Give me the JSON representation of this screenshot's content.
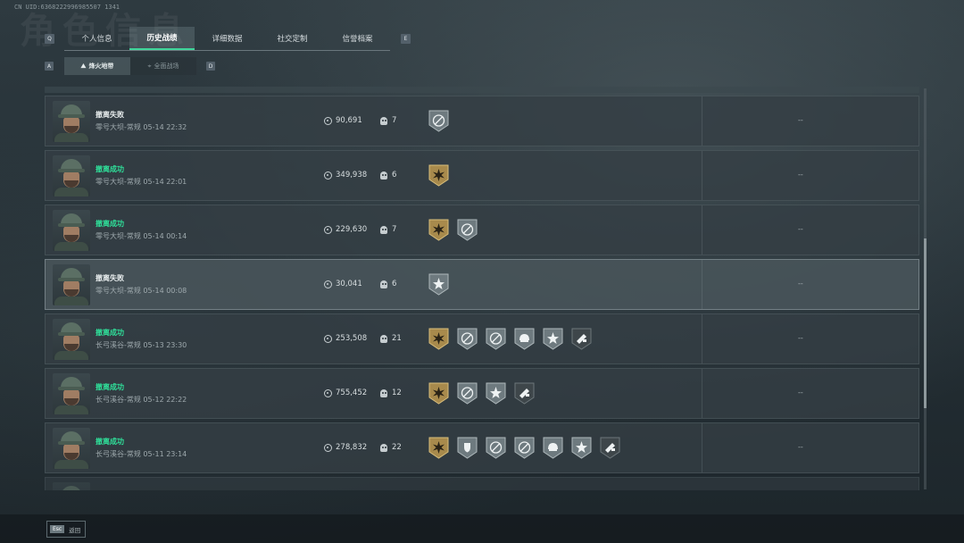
{
  "uid": "CN UID:6368222996985507 1341",
  "bg_title": "角色信息",
  "key_left": "Q",
  "key_right": "E",
  "subkey_left": "A",
  "subkey_right": "D",
  "tabs": [
    "个人信息",
    "历史战绩",
    "详细数据",
    "社交定制",
    "信誉档案"
  ],
  "active_tab": "历史战绩",
  "subtabs": [
    {
      "label": "烽火地带",
      "icon": "mountain-icon"
    },
    {
      "label": "全面战场",
      "icon": "crosshair-icon"
    }
  ],
  "colors": {
    "success": "#2fe09a",
    "fail": "#e6ebec",
    "badge_gold": "#b8995a",
    "badge_silver": "#8c979b"
  },
  "rows": [
    {
      "status": "撤离失败",
      "outcome": "fail",
      "map": "零号大坝-常规 05-14 22:32",
      "money": "90,691",
      "kills": "7",
      "badges": [
        "silver-no-ammo"
      ],
      "right": "--",
      "highlight": false
    },
    {
      "status": "撤离成功",
      "outcome": "ok",
      "map": "零号大坝-常规 05-14 22:01",
      "money": "349,938",
      "kills": "6",
      "badges": [
        "gold-burst"
      ],
      "right": "--",
      "highlight": false
    },
    {
      "status": "撤离成功",
      "outcome": "ok",
      "map": "零号大坝-常规 05-14 00:14",
      "money": "229,630",
      "kills": "7",
      "badges": [
        "gold-burst",
        "silver-no-ammo"
      ],
      "right": "--",
      "highlight": false
    },
    {
      "status": "撤离失败",
      "outcome": "fail",
      "map": "零号大坝-常规 05-14 00:08",
      "money": "30,041",
      "kills": "6",
      "badges": [
        "silver-star"
      ],
      "right": "--",
      "highlight": true
    },
    {
      "status": "撤离成功",
      "outcome": "ok",
      "map": "长弓溪谷-常规 05-13 23:30",
      "money": "253,508",
      "kills": "21",
      "badges": [
        "gold-burst",
        "silver-no-ammo",
        "silver-no-ammo",
        "silver-helmet",
        "silver-star",
        "dark-gun"
      ],
      "right": "--",
      "highlight": false
    },
    {
      "status": "撤离成功",
      "outcome": "ok",
      "map": "长弓溪谷-常规 05-12 22:22",
      "money": "755,452",
      "kills": "12",
      "badges": [
        "gold-burst",
        "silver-no-ammo",
        "silver-star",
        "dark-gun"
      ],
      "right": "--",
      "highlight": false
    },
    {
      "status": "撤离成功",
      "outcome": "ok",
      "map": "长弓溪谷-常规 05-11 23:14",
      "money": "278,832",
      "kills": "22",
      "badges": [
        "gold-burst",
        "silver-shield",
        "silver-no-ammo",
        "silver-no-ammo",
        "silver-helmet",
        "silver-star",
        "dark-gun"
      ],
      "right": "--",
      "highlight": false
    }
  ],
  "footer": {
    "key": "Esc",
    "label": "返回"
  }
}
